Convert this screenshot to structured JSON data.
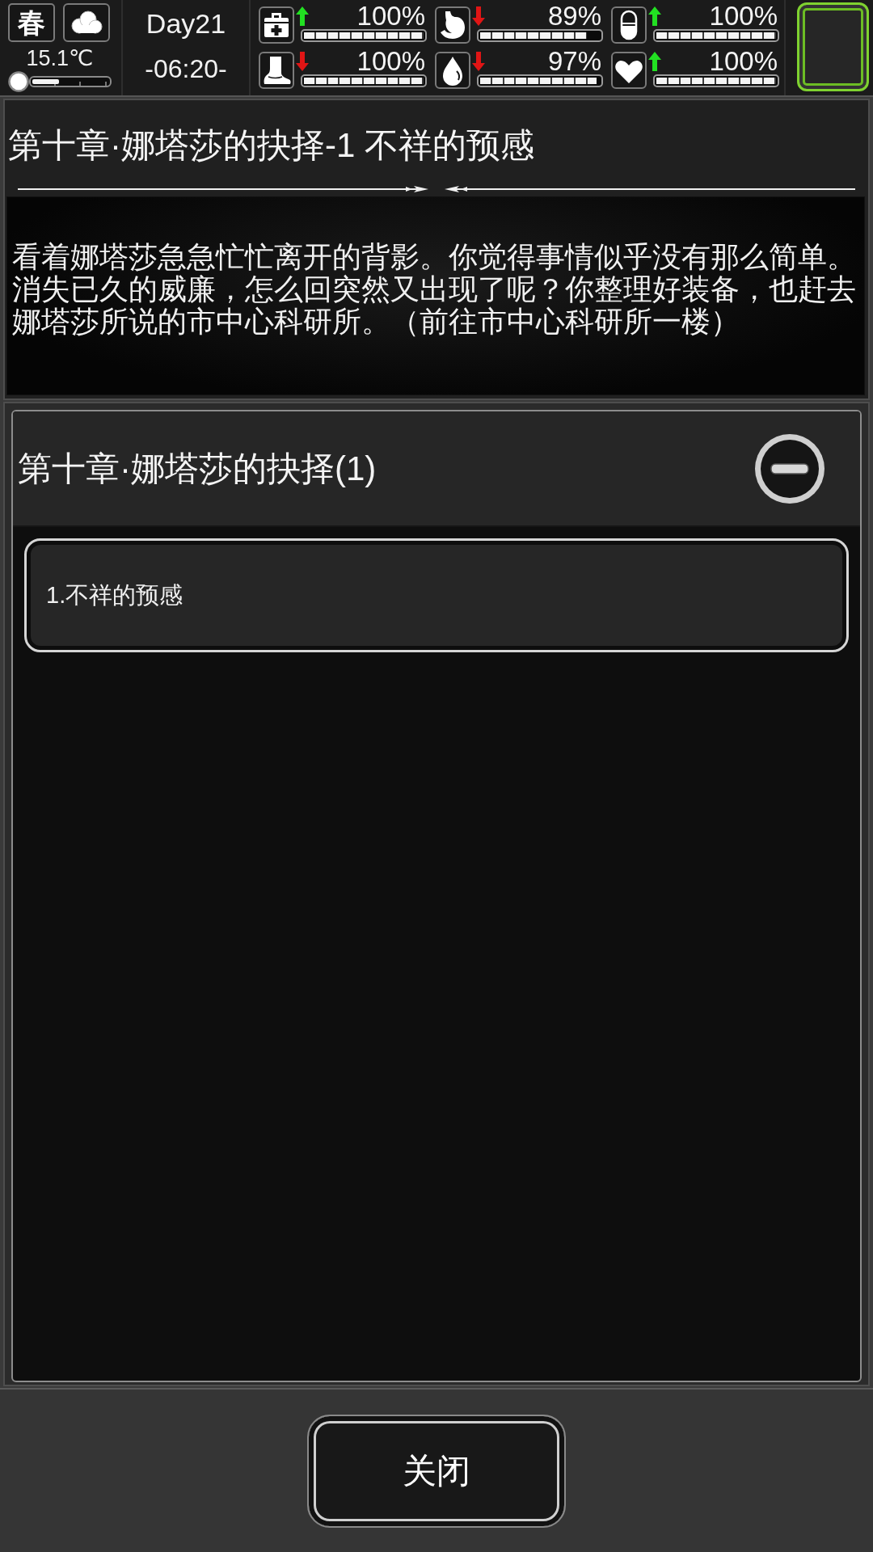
{
  "status_bar": {
    "season": "春",
    "weather": {
      "kind": "cloudy"
    },
    "temperature": "15.1℃",
    "temperature_gauge": {
      "level": 0.35
    },
    "day": "Day21",
    "time": "-06:20-",
    "stats": [
      {
        "kind": "medkit",
        "rising": true,
        "value": "100%",
        "level": 1
      },
      {
        "kind": "stomach",
        "rising": false,
        "value": "89%",
        "level": 0.89
      },
      {
        "kind": "capsule",
        "rising": true,
        "value": "100%",
        "level": 1
      },
      {
        "kind": "foot",
        "rising": false,
        "value": "100%",
        "level": 1
      },
      {
        "kind": "drop",
        "rising": false,
        "value": "97%",
        "level": 0.97
      },
      {
        "kind": "heart",
        "rising": true,
        "value": "100%",
        "level": 1
      }
    ]
  },
  "chapter": {
    "title": "第十章·娜塔莎的抉择-1 不祥的预感",
    "text": "看着娜塔莎急急忙忙离开的背影。你觉得事情似乎没有那么简单。消失已久的威廉，怎么回突然又出现了呢？你整理好装备，也赶去娜塔莎所说的市中心科研所。（前往市中心科研所一楼）"
  },
  "quest_list": {
    "groups": [
      {
        "title": "第十章·娜塔莎的抉择(1)",
        "expanded": true,
        "items": [
          {
            "label": "1.不祥的预感"
          }
        ]
      }
    ]
  },
  "buttons": [
    {
      "label": "关闭"
    }
  ]
}
